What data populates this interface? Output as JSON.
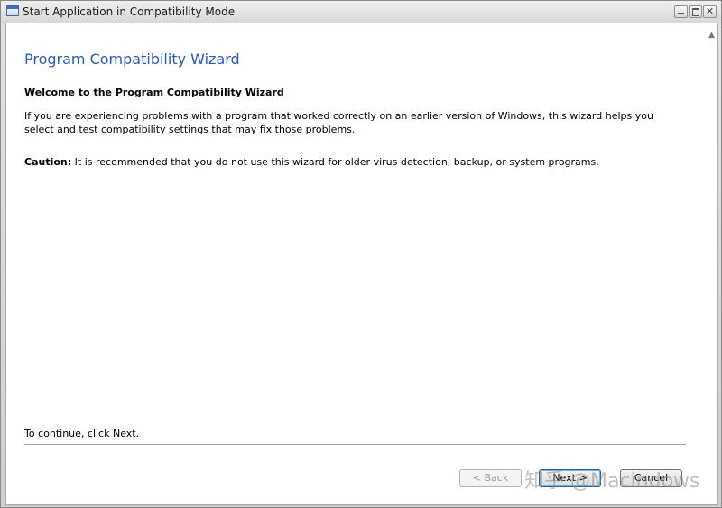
{
  "window": {
    "title": "Start Application in Compatibility Mode",
    "icon": "app-window-icon"
  },
  "caption_buttons": {
    "minimize_icon": "minimize-icon",
    "maximize_icon": "maximize-icon",
    "close_glyph": "✕"
  },
  "wizard": {
    "heading": "Program Compatibility Wizard",
    "subheading": "Welcome to the Program Compatibility Wizard",
    "intro": "If you are experiencing problems with a program that worked correctly on an earlier version of Windows, this wizard helps you select and test compatibility settings that may fix those problems.",
    "caution_label": "Caution:",
    "caution_text": " It is recommended that you do not use this wizard for older virus detection, backup, or system programs.",
    "continue_text": "To continue, click Next."
  },
  "buttons": {
    "back_label": "< Back",
    "back_enabled": false,
    "next_label": "Next >",
    "cancel_label": "Cancel"
  },
  "watermark": "知乎 @Macindows",
  "scroll_arrow": "▲"
}
